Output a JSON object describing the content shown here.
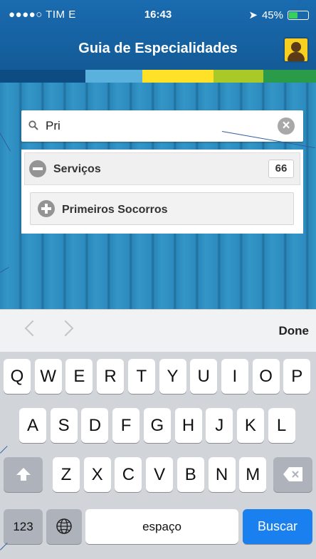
{
  "status_bar": {
    "carrier": "●●●●○ TIM  E",
    "time": "16:43",
    "battery": "45%",
    "battery_level": 0.45
  },
  "header": {
    "title": "Guia de Especialidades"
  },
  "colors": {
    "header_blue": "#1a6bb0",
    "strip": [
      "#0d4c82",
      "#5ab1dd",
      "#ffe227",
      "#a8c927",
      "#2a9b48"
    ],
    "accent_blue": "#1a80f0"
  },
  "search": {
    "value": "Pri",
    "placeholder": ""
  },
  "results": {
    "section_title": "Serviços",
    "section_count": "66",
    "items": [
      {
        "title": "Primeiros Socorros"
      }
    ]
  },
  "accessory": {
    "done_label": "Done"
  },
  "keyboard": {
    "row1": [
      "Q",
      "W",
      "E",
      "R",
      "T",
      "Y",
      "U",
      "I",
      "O",
      "P"
    ],
    "row2": [
      "A",
      "S",
      "D",
      "F",
      "G",
      "H",
      "J",
      "K",
      "L"
    ],
    "row3": [
      "Z",
      "X",
      "C",
      "V",
      "B",
      "N",
      "M"
    ],
    "numbers_label": "123",
    "space_label": "espaço",
    "search_label": "Buscar"
  }
}
